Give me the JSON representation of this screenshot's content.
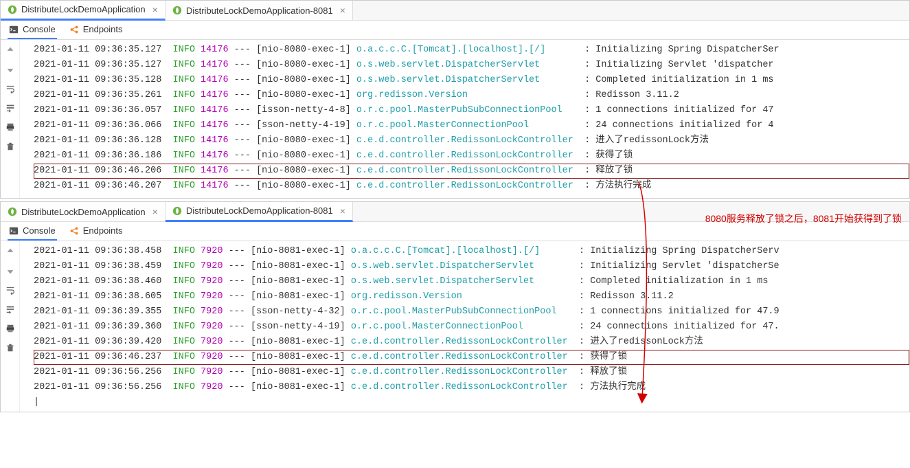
{
  "annotation": "8080服务释放了锁之后，8081开始获得到了锁",
  "panel1": {
    "tabs": [
      {
        "label": "DistributeLockDemoApplication",
        "closable": true
      },
      {
        "label": "DistributeLockDemoApplication-8081",
        "closable": true
      }
    ],
    "activeTab": 0,
    "subtabs": [
      {
        "label": "Console",
        "icon": "terminal-icon"
      },
      {
        "label": "Endpoints",
        "icon": "endpoints-icon"
      }
    ],
    "activeSubtab": 0,
    "logs": [
      {
        "ts": "2021-01-11 09:36:35.127",
        "level": "INFO",
        "pid": "14176",
        "thread": "[nio-8080-exec-1]",
        "source": "o.a.c.c.C.[Tomcat].[localhost].[/]      ",
        "msg": "Initializing Spring DispatcherSer"
      },
      {
        "ts": "2021-01-11 09:36:35.127",
        "level": "INFO",
        "pid": "14176",
        "thread": "[nio-8080-exec-1]",
        "source": "o.s.web.servlet.DispatcherServlet       ",
        "msg": "Initializing Servlet 'dispatcher"
      },
      {
        "ts": "2021-01-11 09:36:35.128",
        "level": "INFO",
        "pid": "14176",
        "thread": "[nio-8080-exec-1]",
        "source": "o.s.web.servlet.DispatcherServlet       ",
        "msg": "Completed initialization in 1 ms"
      },
      {
        "ts": "2021-01-11 09:36:35.261",
        "level": "INFO",
        "pid": "14176",
        "thread": "[nio-8080-exec-1]",
        "source": "org.redisson.Version                    ",
        "msg": "Redisson 3.11.2"
      },
      {
        "ts": "2021-01-11 09:36:36.057",
        "level": "INFO",
        "pid": "14176",
        "thread": "[isson-netty-4-8]",
        "source": "o.r.c.pool.MasterPubSubConnectionPool   ",
        "msg": "1 connections initialized for 47"
      },
      {
        "ts": "2021-01-11 09:36:36.066",
        "level": "INFO",
        "pid": "14176",
        "thread": "[sson-netty-4-19]",
        "source": "o.r.c.pool.MasterConnectionPool         ",
        "msg": "24 connections initialized for 4"
      },
      {
        "ts": "2021-01-11 09:36:36.128",
        "level": "INFO",
        "pid": "14176",
        "thread": "[nio-8080-exec-1]",
        "source": "c.e.d.controller.RedissonLockController ",
        "msg": "进入了redissonLock方法"
      },
      {
        "ts": "2021-01-11 09:36:36.186",
        "level": "INFO",
        "pid": "14176",
        "thread": "[nio-8080-exec-1]",
        "source": "c.e.d.controller.RedissonLockController ",
        "msg": "获得了锁"
      },
      {
        "ts": "2021-01-11 09:36:46.206",
        "level": "INFO",
        "pid": "14176",
        "thread": "[nio-8080-exec-1]",
        "source": "c.e.d.controller.RedissonLockController ",
        "msg": "释放了锁",
        "highlighted": true
      },
      {
        "ts": "2021-01-11 09:36:46.207",
        "level": "INFO",
        "pid": "14176",
        "thread": "[nio-8080-exec-1]",
        "source": "c.e.d.controller.RedissonLockController ",
        "msg": "方法执行完成"
      }
    ]
  },
  "panel2": {
    "tabs": [
      {
        "label": "DistributeLockDemoApplication",
        "closable": true
      },
      {
        "label": "DistributeLockDemoApplication-8081",
        "closable": true
      }
    ],
    "activeTab": 1,
    "subtabs": [
      {
        "label": "Console",
        "icon": "terminal-icon"
      },
      {
        "label": "Endpoints",
        "icon": "endpoints-icon"
      }
    ],
    "activeSubtab": 0,
    "logs": [
      {
        "ts": "2021-01-11 09:36:38.458",
        "level": "INFO",
        "pid": "7920",
        "thread": "[nio-8081-exec-1]",
        "source": "o.a.c.c.C.[Tomcat].[localhost].[/]      ",
        "msg": "Initializing Spring DispatcherServ"
      },
      {
        "ts": "2021-01-11 09:36:38.459",
        "level": "INFO",
        "pid": "7920",
        "thread": "[nio-8081-exec-1]",
        "source": "o.s.web.servlet.DispatcherServlet       ",
        "msg": "Initializing Servlet 'dispatcherSe"
      },
      {
        "ts": "2021-01-11 09:36:38.460",
        "level": "INFO",
        "pid": "7920",
        "thread": "[nio-8081-exec-1]",
        "source": "o.s.web.servlet.DispatcherServlet       ",
        "msg": "Completed initialization in 1 ms"
      },
      {
        "ts": "2021-01-11 09:36:38.605",
        "level": "INFO",
        "pid": "7920",
        "thread": "[nio-8081-exec-1]",
        "source": "org.redisson.Version                    ",
        "msg": "Redisson 3.11.2"
      },
      {
        "ts": "2021-01-11 09:36:39.355",
        "level": "INFO",
        "pid": "7920",
        "thread": "[sson-netty-4-32]",
        "source": "o.r.c.pool.MasterPubSubConnectionPool   ",
        "msg": "1 connections initialized for 47.9"
      },
      {
        "ts": "2021-01-11 09:36:39.360",
        "level": "INFO",
        "pid": "7920",
        "thread": "[sson-netty-4-19]",
        "source": "o.r.c.pool.MasterConnectionPool         ",
        "msg": "24 connections initialized for 47."
      },
      {
        "ts": "2021-01-11 09:36:39.420",
        "level": "INFO",
        "pid": "7920",
        "thread": "[nio-8081-exec-1]",
        "source": "c.e.d.controller.RedissonLockController ",
        "msg": "进入了redissonLock方法"
      },
      {
        "ts": "2021-01-11 09:36:46.237",
        "level": "INFO",
        "pid": "7920",
        "thread": "[nio-8081-exec-1]",
        "source": "c.e.d.controller.RedissonLockController ",
        "msg": "获得了锁",
        "highlighted": true
      },
      {
        "ts": "2021-01-11 09:36:56.256",
        "level": "INFO",
        "pid": "7920",
        "thread": "[nio-8081-exec-1]",
        "source": "c.e.d.controller.RedissonLockController ",
        "msg": "释放了锁"
      },
      {
        "ts": "2021-01-11 09:36:56.256",
        "level": "INFO",
        "pid": "7920",
        "thread": "[nio-8081-exec-1]",
        "source": "c.e.d.controller.RedissonLockController ",
        "msg": "方法执行完成"
      }
    ]
  }
}
